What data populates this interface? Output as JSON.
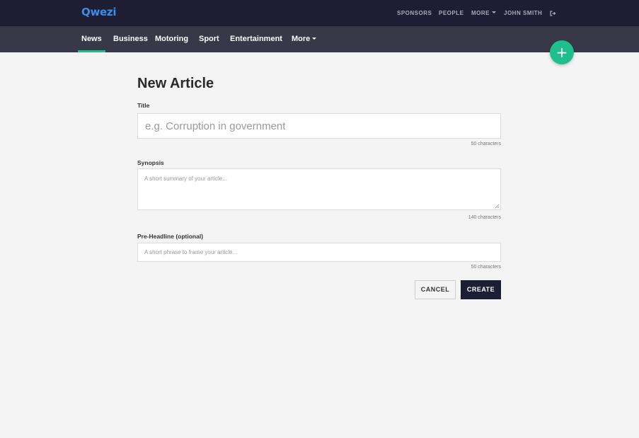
{
  "brand": {
    "logo": "Qwezi",
    "accent": "#3b8eea"
  },
  "topbar": {
    "links": [
      {
        "label": "SPONSORS"
      },
      {
        "label": "PEOPLE"
      },
      {
        "label": "MORE"
      },
      {
        "label": "JOHN SMITH"
      }
    ],
    "logout_icon": "sign-out-icon",
    "background": "#1d1e33"
  },
  "navbar": {
    "items": [
      {
        "label": "News",
        "active": true
      },
      {
        "label": "Business"
      },
      {
        "label": "Motoring"
      },
      {
        "label": "Sport"
      },
      {
        "label": "Entertainment"
      },
      {
        "label": "More"
      }
    ],
    "active_color": "#1fbe8c"
  },
  "fab": {
    "icon": "plus-icon",
    "symbol": "+",
    "color": "#1fbe8c"
  },
  "form": {
    "heading": "New Article",
    "title": {
      "label": "Title",
      "placeholder": "e.g. Corruption in government",
      "value": "",
      "limit": "50 characters"
    },
    "synopsis": {
      "label": "Synopsis",
      "placeholder": "A short summary of your article...",
      "value": "",
      "limit": "140 characters"
    },
    "preheadline": {
      "label": "Pre-Headline (optional)",
      "placeholder": "A short phrase to frame your article...",
      "value": "",
      "limit": "50 characters"
    },
    "cancel_label": "CANCEL",
    "create_label": "CREATE"
  }
}
